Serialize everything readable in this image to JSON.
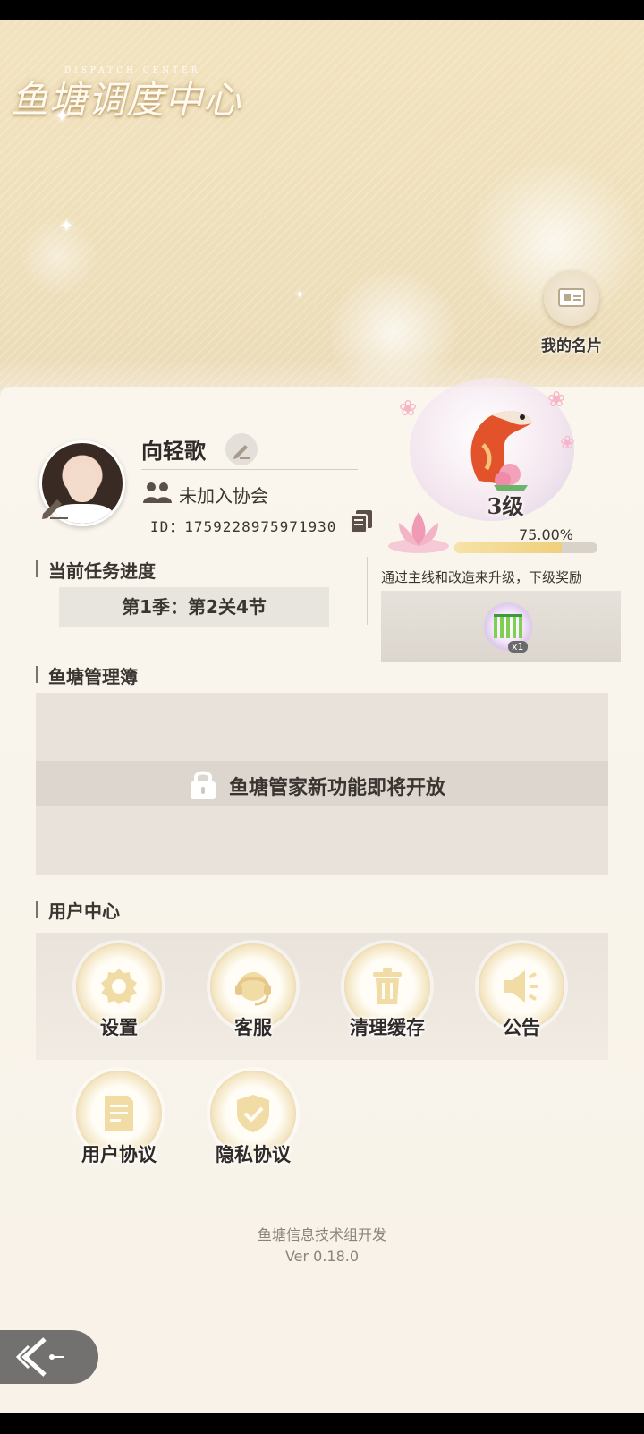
{
  "header": {
    "title": "鱼塘调度中心",
    "subtitle_en": "DISPATCH CENTER"
  },
  "business_card": {
    "label": "我的名片"
  },
  "profile": {
    "name": "向轻歌",
    "association": "未加入协会",
    "id_text": "ID：1759228975971930"
  },
  "level": {
    "text": "3级",
    "progress_text": "75.00%",
    "progress": 0.75,
    "upgrade_hint": "通过主线和改造来升级，下级奖励",
    "reward_count": "x1"
  },
  "task": {
    "heading": "当前任务进度",
    "progress": "第1季：第2关4节"
  },
  "management": {
    "heading": "鱼塘管理簿",
    "locked_text": "鱼塘管家新功能即将开放"
  },
  "user_center": {
    "heading": "用户中心",
    "items": [
      {
        "label": "设置",
        "icon": "gear-icon"
      },
      {
        "label": "客服",
        "icon": "headset-icon"
      },
      {
        "label": "清理缓存",
        "icon": "trash-icon"
      },
      {
        "label": "公告",
        "icon": "speaker-icon"
      },
      {
        "label": "用户协议",
        "icon": "document-icon"
      },
      {
        "label": "隐私协议",
        "icon": "shield-check-icon"
      }
    ]
  },
  "footer": {
    "developer": "鱼塘信息技术组开发",
    "version": "Ver 0.18.0"
  },
  "colors": {
    "header_bg": "#efe0bb",
    "panel_bg": "#f7efe2",
    "text_dark": "#3b3531",
    "progress_fill": "#f0cf7c"
  }
}
